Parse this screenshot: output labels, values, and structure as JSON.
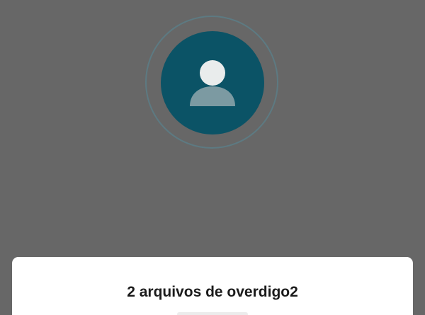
{
  "window": {
    "background_color": "#676767"
  },
  "avatar": {
    "icon": "person-icon",
    "background_color": "#0b5366",
    "ring_color": "#5d7a82"
  },
  "sheet": {
    "title": "2 arquivos de overdigo2"
  }
}
